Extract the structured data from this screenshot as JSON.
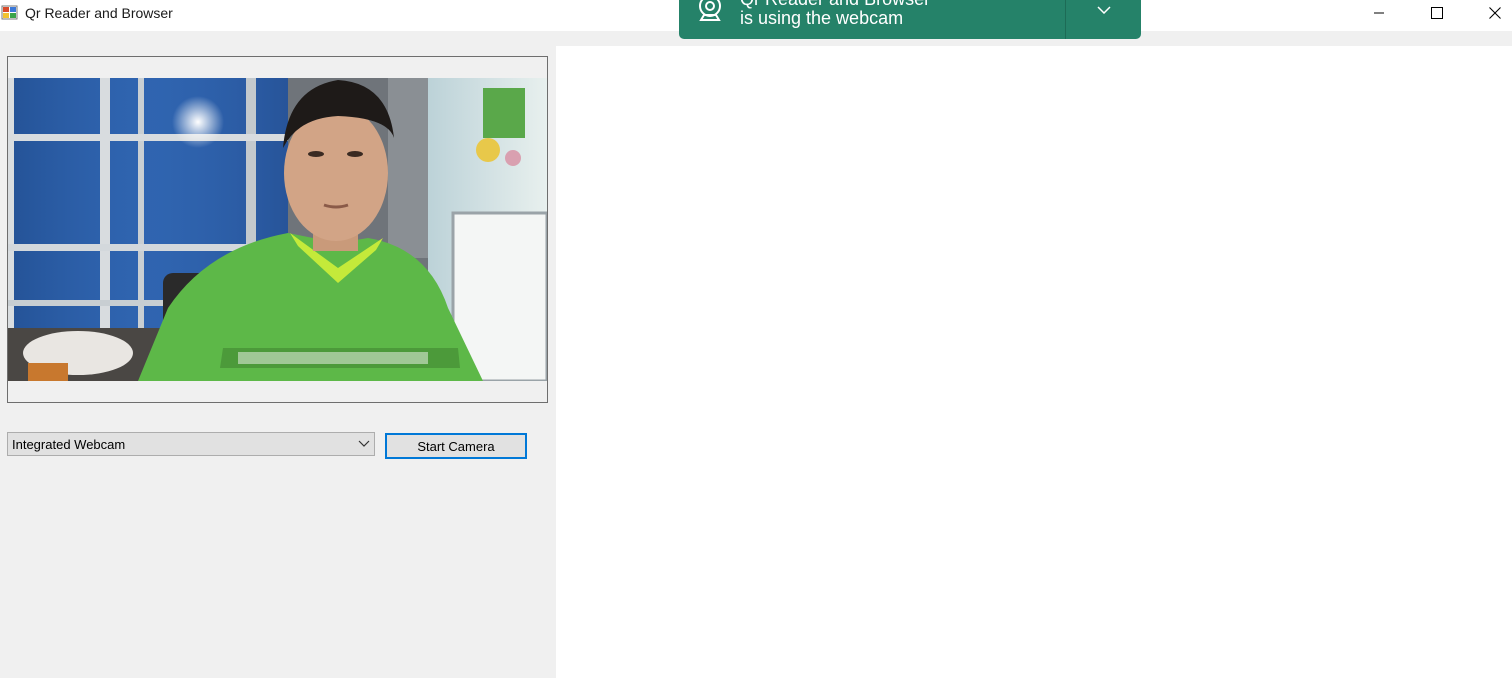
{
  "window": {
    "title": "Qr Reader and Browser",
    "icon": "app-icon",
    "controls": [
      "minimize-icon",
      "maximize-icon",
      "close-icon"
    ]
  },
  "toast": {
    "line1": "Qr Reader and Browser",
    "line2": "is using the webcam",
    "icon": "webcam-icon",
    "expand_icon": "chevron-down-icon",
    "color": "#258269"
  },
  "camera": {
    "device_select": {
      "selected": "Integrated Webcam"
    },
    "start_button_label": "Start Camera"
  },
  "colors": {
    "focus_blue": "#0078d7",
    "panel_bg": "#f0f0f0",
    "browser_bg": "#ffffff"
  }
}
